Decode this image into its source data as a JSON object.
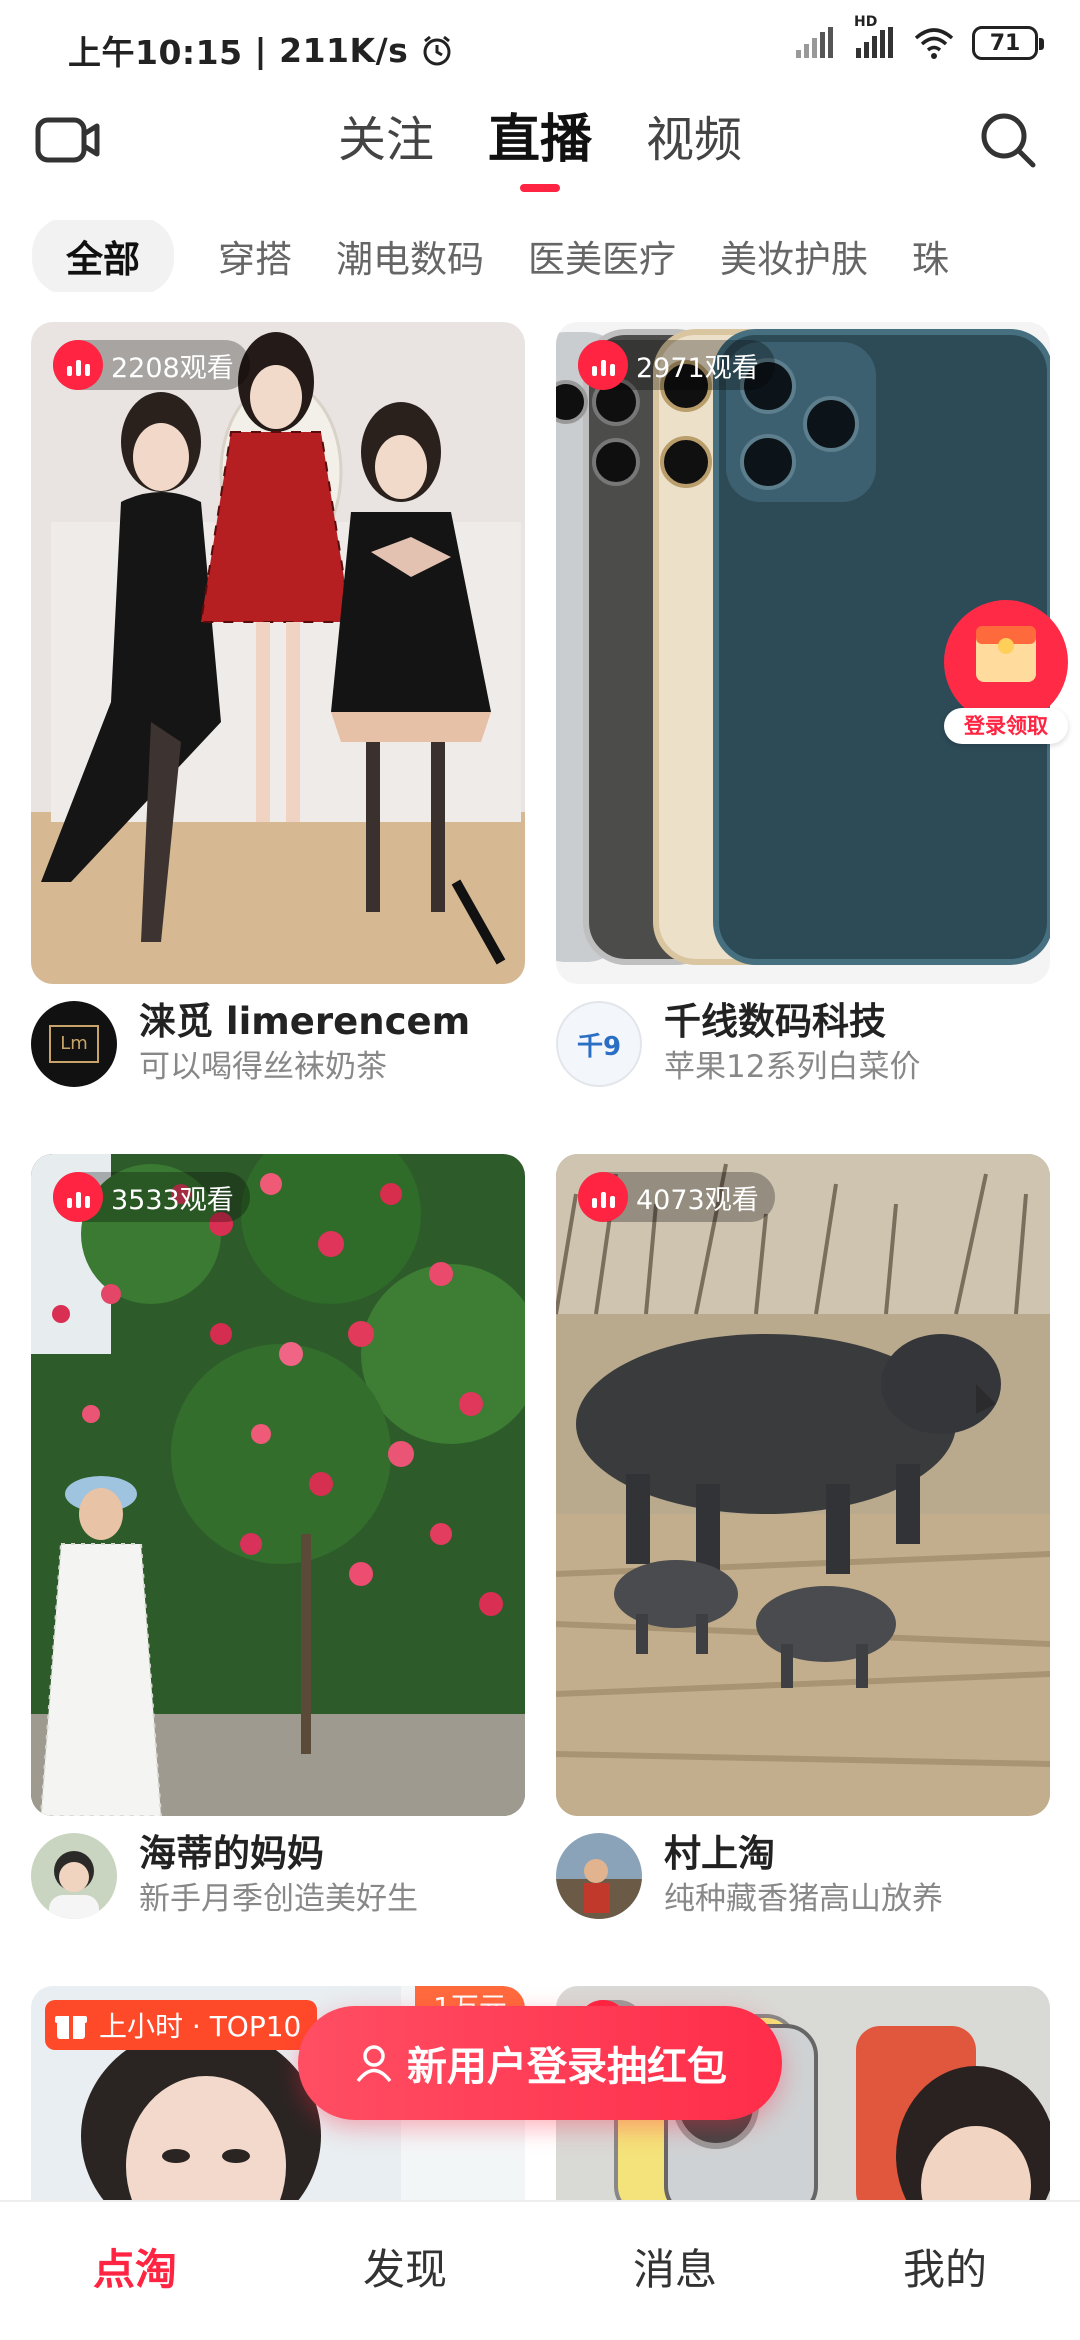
{
  "status_bar": {
    "time": "上午10:15",
    "speed": "211K/s",
    "battery": "71",
    "hd_label": "HD"
  },
  "header": {
    "tabs": [
      {
        "label": "关注",
        "active": false
      },
      {
        "label": "直播",
        "active": true
      },
      {
        "label": "视频",
        "active": false
      }
    ]
  },
  "categories": [
    {
      "label": "全部",
      "active": true
    },
    {
      "label": "穿搭",
      "active": false
    },
    {
      "label": "潮电数码",
      "active": false
    },
    {
      "label": "医美医疗",
      "active": false
    },
    {
      "label": "美妆护肤",
      "active": false
    },
    {
      "label": "珠",
      "active": false
    }
  ],
  "cards": [
    {
      "views": "2208观看",
      "streamer": "涞觅 limerencem",
      "subtitle": "可以喝得丝袜奶茶",
      "avatar_text": "Lm"
    },
    {
      "views": "2971观看",
      "streamer": "千线数码科技",
      "subtitle": "苹果12系列白菜价",
      "avatar_text": "千9"
    },
    {
      "views": "3533观看",
      "streamer": "海蒂的妈妈",
      "subtitle": "新手月季创造美好生",
      "avatar_text": ""
    },
    {
      "views": "4073观看",
      "streamer": "村上淘",
      "subtitle": "纯种藏香猪高山放养",
      "avatar_text": ""
    }
  ],
  "partial_cards": {
    "left_badge": "上小时 · TOP10",
    "left_tag": "1万元"
  },
  "red_packet": {
    "label": "登录领取"
  },
  "login_prompt": {
    "label": "新用户登录抽红包"
  },
  "tabbar": [
    {
      "label": "点淘",
      "active": true
    },
    {
      "label": "发现",
      "active": false
    },
    {
      "label": "消息",
      "active": false
    },
    {
      "label": "我的",
      "active": false
    }
  ],
  "colors": {
    "accent": "#ff2442",
    "text": "#222222",
    "muted": "#888888"
  }
}
